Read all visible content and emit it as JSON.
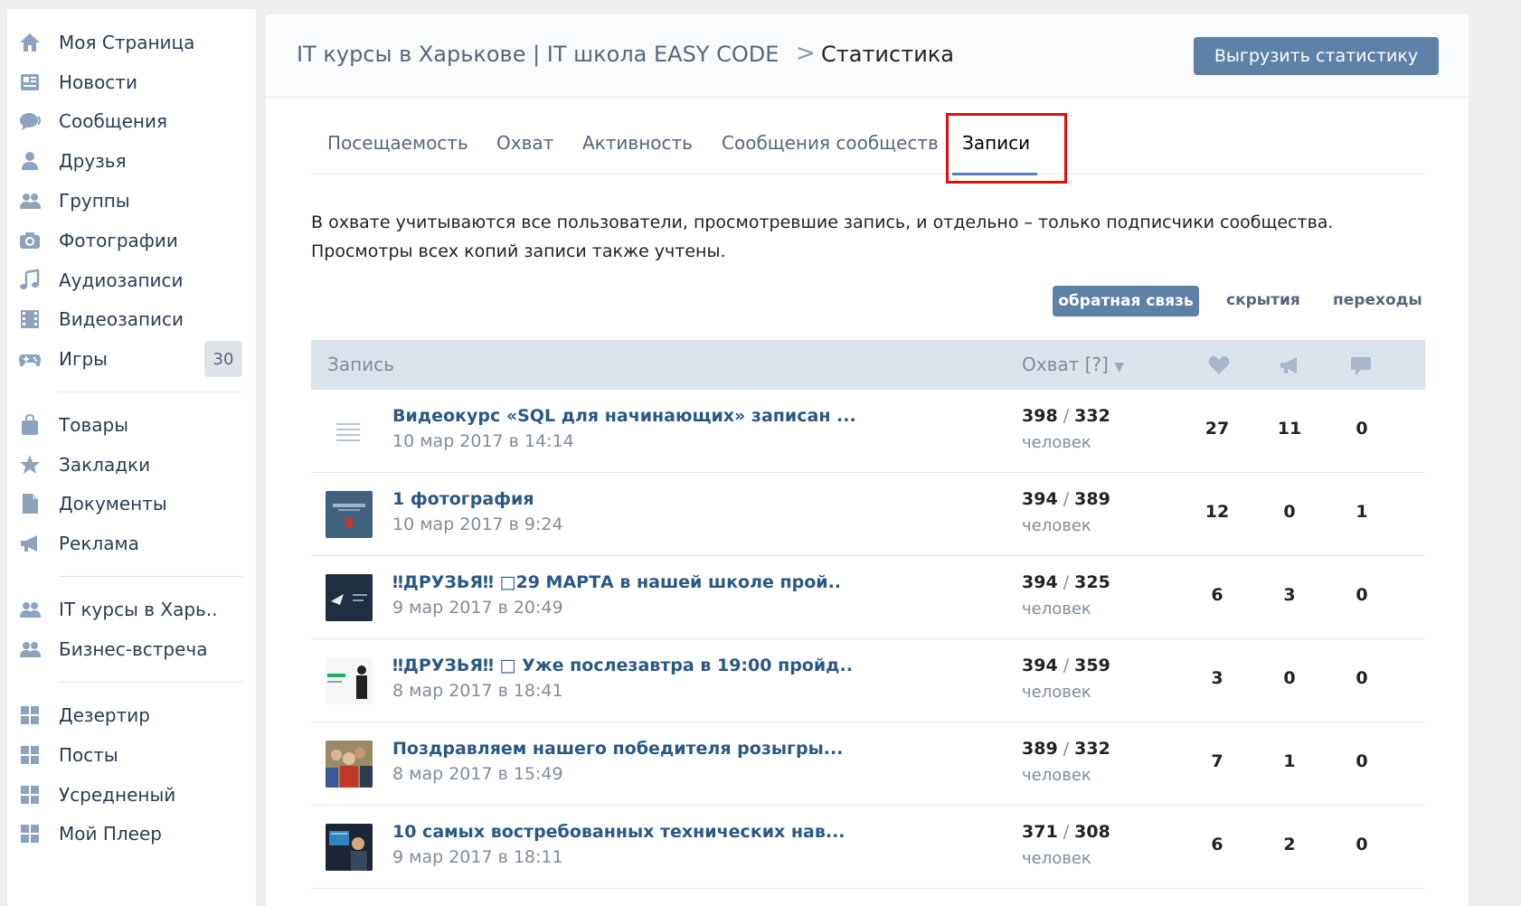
{
  "sidebar": {
    "items": [
      {
        "label": "Моя Страница",
        "icon": "home-icon"
      },
      {
        "label": "Новости",
        "icon": "news-icon"
      },
      {
        "label": "Сообщения",
        "icon": "messages-icon"
      },
      {
        "label": "Друзья",
        "icon": "friend-icon"
      },
      {
        "label": "Группы",
        "icon": "groups-icon"
      },
      {
        "label": "Фотографии",
        "icon": "camera-icon"
      },
      {
        "label": "Аудиозаписи",
        "icon": "music-note-icon"
      },
      {
        "label": "Видеозаписи",
        "icon": "film-icon"
      },
      {
        "label": "Игры",
        "icon": "gamepad-icon",
        "badge": "30"
      },
      {
        "label": "Товары",
        "icon": "shopping-bag-icon"
      },
      {
        "label": "Закладки",
        "icon": "star-icon"
      },
      {
        "label": "Документы",
        "icon": "document-icon"
      },
      {
        "label": "Реклама",
        "icon": "megaphone-icon"
      },
      {
        "label": "IT курсы в Харь..",
        "icon": "groups-icon"
      },
      {
        "label": "Бизнес-встреча",
        "icon": "groups-icon"
      },
      {
        "label": "Дезертир",
        "icon": "app-grid-icon"
      },
      {
        "label": "Посты",
        "icon": "app-grid-icon"
      },
      {
        "label": "Усредненый",
        "icon": "app-grid-icon"
      },
      {
        "label": "Мой Плеер",
        "icon": "app-grid-icon"
      }
    ]
  },
  "header": {
    "group_name": "IT курсы в Харькове | IT школа EASY CODE",
    "separator": ">",
    "page_title": "Статистика",
    "export_label": "Выгрузить статистику"
  },
  "tabs": [
    {
      "label": "Посещаемость",
      "active": false
    },
    {
      "label": "Охват",
      "active": false
    },
    {
      "label": "Активность",
      "active": false
    },
    {
      "label": "Сообщения сообществ",
      "active": false
    },
    {
      "label": "Записи",
      "active": true
    }
  ],
  "info": {
    "line1": "В охвате учитываются все пользователи, просмотревшие запись, и отдельно – только подписчики сообщества.",
    "line2": "Просмотры всех копий записи также учтены."
  },
  "filters": {
    "active": "обратная связь",
    "hidden": "скрытия",
    "transitions": "переходы"
  },
  "table": {
    "col_post": "Запись",
    "col_reach": "Охват [?]",
    "col_likes_icon": "heart-icon",
    "col_reposts_icon": "megaphone-icon",
    "col_comments_icon": "comment-icon",
    "rows": [
      {
        "title": "Видеокурс «SQL для начинающих» записан ...",
        "date": "10 мар 2017 в 14:14",
        "reach_all": "398",
        "reach_sub": "332",
        "unit": "человек",
        "likes": "27",
        "reposts": "11",
        "comments": "0",
        "thumb": "text-lines"
      },
      {
        "title": "1 фотография",
        "date": "10 мар 2017 в 9:24",
        "reach_all": "394",
        "reach_sub": "389",
        "unit": "человек",
        "likes": "12",
        "reposts": "0",
        "comments": "1",
        "thumb": "photo-blue"
      },
      {
        "title": "‼ДРУЗЬЯ‼ □29 МАРТА в нашей школе прой..",
        "date": "9 мар 2017 в 20:49",
        "reach_all": "394",
        "reach_sub": "325",
        "unit": "человек",
        "likes": "6",
        "reposts": "3",
        "comments": "0",
        "thumb": "photo-dark"
      },
      {
        "title": "‼ДРУЗЬЯ‼ □ Уже послезавтра в 19:00 пройд..",
        "date": "8 мар 2017 в 18:41",
        "reach_all": "394",
        "reach_sub": "359",
        "unit": "человек",
        "likes": "3",
        "reposts": "0",
        "comments": "0",
        "thumb": "photo-white"
      },
      {
        "title": "Поздравляем нашего победителя розыгры...",
        "date": "8 мар 2017 в 15:49",
        "reach_all": "389",
        "reach_sub": "332",
        "unit": "человек",
        "likes": "7",
        "reposts": "1",
        "comments": "0",
        "thumb": "photo-crowd"
      },
      {
        "title": "10 самых востребованных технических нав...",
        "date": "9 мар 2017 в 18:11",
        "reach_all": "371",
        "reach_sub": "308",
        "unit": "человек",
        "likes": "6",
        "reposts": "2",
        "comments": "0",
        "thumb": "photo-screen"
      }
    ]
  },
  "colors": {
    "accent": "#5e81a8",
    "link": "#2a5885",
    "highlight": "#e10e0e",
    "page_bg": "#edeef0"
  }
}
